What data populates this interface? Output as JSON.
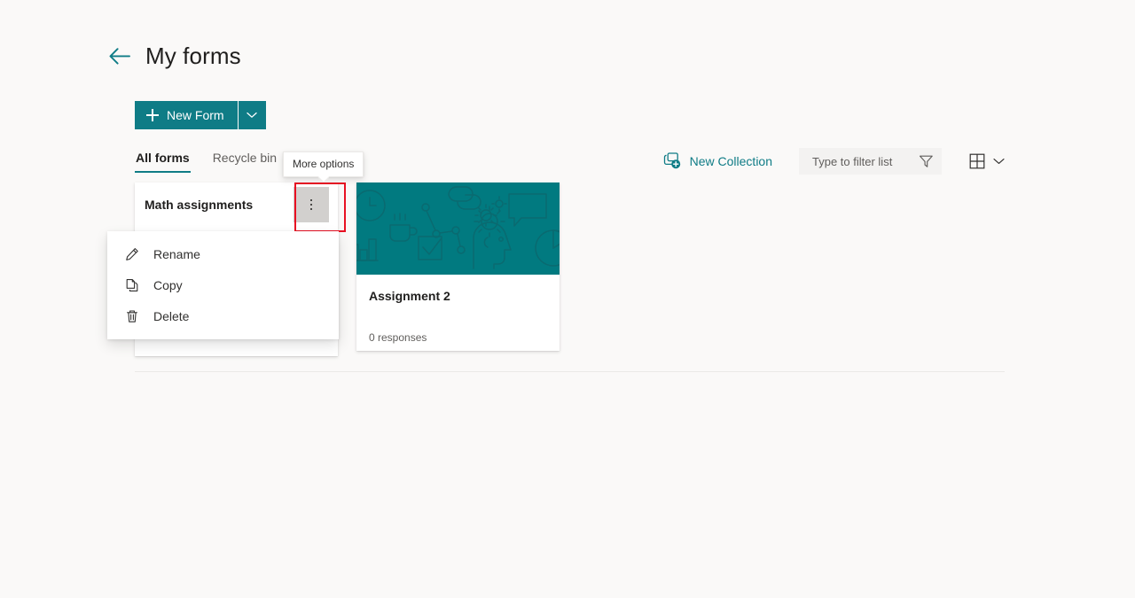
{
  "header": {
    "back_icon": "back-arrow-icon",
    "title": "My forms"
  },
  "toolbar_primary": {
    "new_form_label": "New Form",
    "new_form_plus_icon": "plus-icon",
    "new_form_split_icon": "chevron-down-icon"
  },
  "tabs": [
    {
      "label": "All forms",
      "active": true
    },
    {
      "label": "Recycle bin",
      "active": false
    }
  ],
  "toolbar_secondary": {
    "new_collection_label": "New Collection",
    "new_collection_icon": "new-collection-icon",
    "filter_placeholder": "Type to filter list",
    "filter_value": "",
    "filter_icon": "funnel-icon",
    "view_icon": "grid-view-icon",
    "view_chevron_icon": "chevron-down-icon"
  },
  "tooltip": {
    "text": "More options"
  },
  "collection": {
    "name": "Math assignments",
    "more_options_icon": "more-options-icon",
    "highlight_color": "#e81123"
  },
  "context_menu": {
    "items": [
      {
        "label": "Rename",
        "icon": "pencil-icon"
      },
      {
        "label": "Copy",
        "icon": "copy-icon"
      },
      {
        "label": "Delete",
        "icon": "trash-icon"
      }
    ]
  },
  "form_card": {
    "title": "Assignment 2",
    "responses": "0 responses",
    "banner_color": "#017a80",
    "banner_icons": [
      "clock-icon",
      "coffee-cup-icon",
      "bar-chart-icon",
      "checkbox-icon",
      "network-nodes-icon",
      "cloud-link-icon",
      "gears-icon",
      "head-gear-icon",
      "chat-bubble-icon",
      "pie-chart-icon"
    ]
  },
  "theme": {
    "accent": "#0f7c86",
    "background": "#faf9f8"
  }
}
